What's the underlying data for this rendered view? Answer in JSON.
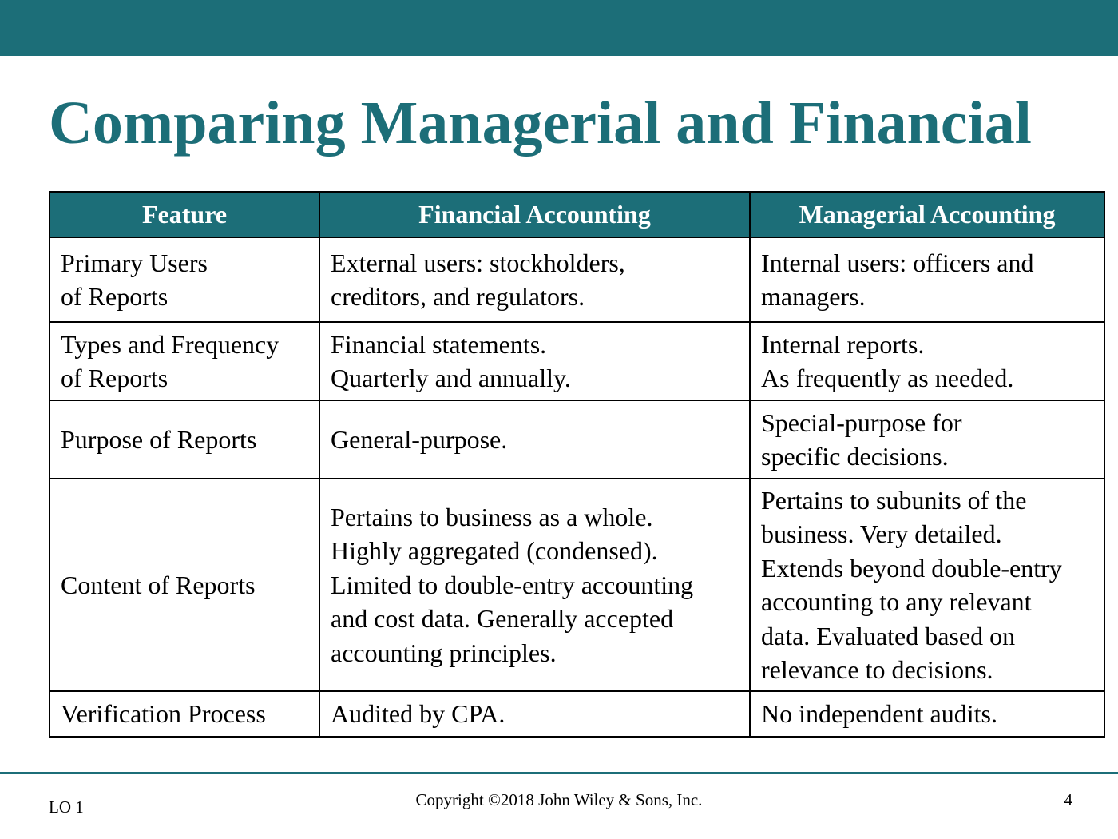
{
  "slide": {
    "title": "Comparing Managerial and Financial",
    "colors": {
      "accent": "#1c6e78",
      "header_text": "#ffffff",
      "border": "#000000"
    }
  },
  "table": {
    "headers": [
      "Feature",
      "Financial Accounting",
      "Managerial Accounting"
    ],
    "rows": [
      {
        "feature": [
          "Primary Users",
          "of Reports"
        ],
        "financial": [
          "External users: stockholders,",
          "creditors, and regulators."
        ],
        "managerial": [
          "Internal users: officers and",
          "managers."
        ]
      },
      {
        "feature": [
          "Types and Frequency",
          "of Reports"
        ],
        "financial": [
          "Financial statements.",
          "Quarterly and annually."
        ],
        "managerial": [
          "Internal reports.",
          "As frequently as needed."
        ]
      },
      {
        "feature": [
          "Purpose of Reports"
        ],
        "financial": [
          "General-purpose."
        ],
        "managerial": [
          "Special-purpose for",
          "specific decisions."
        ]
      },
      {
        "feature": [
          "Content of Reports"
        ],
        "financial": [
          "Pertains to business as a whole.",
          "Highly aggregated (condensed).",
          "Limited to double-entry accounting",
          "and cost data. Generally accepted",
          "accounting principles."
        ],
        "managerial": [
          "Pertains to subunits of the",
          "business. Very detailed.",
          "Extends beyond double-entry",
          "accounting to any relevant",
          "data. Evaluated based on",
          "relevance to decisions."
        ]
      },
      {
        "feature": [
          "Verification Process"
        ],
        "financial": [
          "Audited by CPA."
        ],
        "managerial": [
          "No independent audits."
        ]
      }
    ]
  },
  "footer": {
    "learning_objective": "LO 1",
    "copyright": "Copyright ©2018 John Wiley & Sons, Inc.",
    "page_number": "4"
  }
}
